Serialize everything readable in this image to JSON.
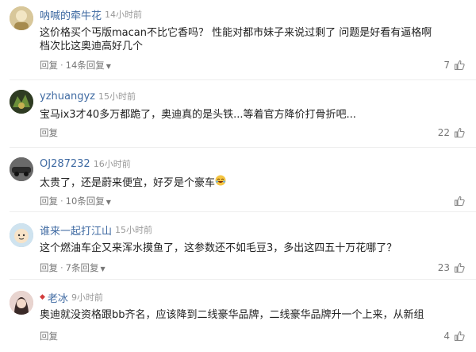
{
  "reply_label": "回复",
  "comments": [
    {
      "username": "呐喊的牵牛花",
      "time": "14小时前",
      "text": "这价格买个丐版macan不比它香吗？ 性能对都市妹子来说过剩了 问题是好看有逼格啊 档次比这奥迪高好几个",
      "replies": "14条回复",
      "likes": "7",
      "avatar_color": "#c9b27a",
      "pinned": false
    },
    {
      "username": "yzhuangyz",
      "time": "15小时前",
      "text": "宝马ix3才40多万都跪了，奥迪真的是头铁...等着官方降价打骨折吧...",
      "replies": "",
      "likes": "22",
      "avatar_color": "#3b4a2a",
      "pinned": false
    },
    {
      "username": "OJ287232",
      "time": "16小时前",
      "text": "太贵了，还是蔚来便宜，好歹是个豪车",
      "replies": "10条回复",
      "likes": "",
      "avatar_color": "#4a4a4a",
      "pinned": false
    },
    {
      "username": "谁来一起打江山",
      "time": "15小时前",
      "text": "这个燃油车企又来浑水摸鱼了，这参数还不如毛豆3，多出这四五十万花哪了？",
      "replies": "7条回复",
      "likes": "23",
      "avatar_color": "#8fb7d8",
      "pinned": false
    },
    {
      "username": "老冰",
      "time": "9小时前",
      "text": "奥迪就没资格跟bb齐名，应该降到二线豪华品牌，二线豪华品牌升一个上来，从新组合三巨头",
      "replies": "",
      "likes": "4",
      "avatar_color": "#d9a3a3",
      "pinned": true
    }
  ]
}
